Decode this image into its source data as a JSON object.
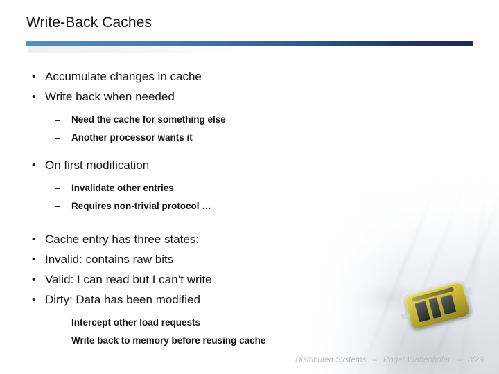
{
  "slide": {
    "title": "Write-Back Caches",
    "accent_left": "#4d92c6",
    "accent_right": "#1b2a5c",
    "text_color": "#141414"
  },
  "content": {
    "blocks": [
      {
        "level": 1,
        "marker": "•",
        "text": "Accumulate changes in cache"
      },
      {
        "level": 1,
        "marker": "•",
        "text": "Write back when needed"
      },
      {
        "level": 2,
        "marker": "–",
        "text": "Need the cache for something else"
      },
      {
        "level": 2,
        "marker": "–",
        "text": "Another processor wants it"
      },
      {
        "level": 1,
        "marker": "•",
        "text": "On first modification"
      },
      {
        "level": 2,
        "marker": "–",
        "text": "Invalidate other entries"
      },
      {
        "level": 2,
        "marker": "–",
        "text": "Requires non-trivial protocol …"
      },
      {
        "level": 1,
        "marker": "•",
        "text": "Cache entry has three states:"
      },
      {
        "level": 1,
        "marker": "•",
        "text": "Invalid: contains raw bits"
      },
      {
        "level": 1,
        "marker": "•",
        "text": "Valid: I can read but I can’t write"
      },
      {
        "level": 1,
        "marker": "•",
        "text": "Dirty: Data has been modified"
      },
      {
        "level": 2,
        "marker": "–",
        "text": "Intercept other load requests"
      },
      {
        "level": 2,
        "marker": "–",
        "text": "Write back to memory before reusing cache"
      }
    ]
  },
  "footer": {
    "course": "Distributed Systems",
    "separator1": "–",
    "author": "Roger Wattenhofer",
    "separator2": "–",
    "page": "8/29"
  },
  "decoration": {
    "photo_alt": "sensor-mote-on-snow"
  }
}
